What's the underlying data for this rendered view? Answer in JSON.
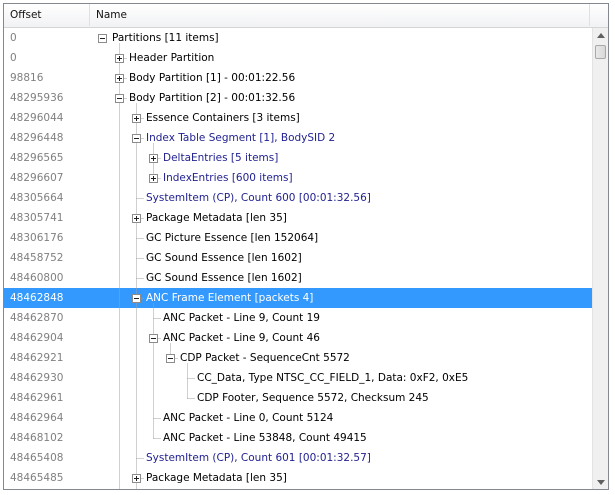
{
  "header": {
    "offset": "Offset",
    "name": "Name"
  },
  "rows": [
    {
      "offset": "0",
      "label": "Partitions [11 items]",
      "depth": 0,
      "expander": "minus",
      "blue": false
    },
    {
      "offset": "0",
      "label": "Header Partition",
      "depth": 1,
      "expander": "plus",
      "blue": false
    },
    {
      "offset": "98816",
      "label": "Body Partition [1] - 00:01:22.56",
      "depth": 1,
      "expander": "plus",
      "blue": false
    },
    {
      "offset": "48295936",
      "label": "Body Partition [2] - 00:01:32.56",
      "depth": 1,
      "expander": "minus",
      "blue": false
    },
    {
      "offset": "48296044",
      "label": "Essence Containers [3 items]",
      "depth": 2,
      "expander": "plus",
      "blue": false
    },
    {
      "offset": "48296448",
      "label": "Index Table Segment [1], BodySID 2",
      "depth": 2,
      "expander": "minus",
      "blue": true
    },
    {
      "offset": "48296565",
      "label": "DeltaEntries [5 items]",
      "depth": 3,
      "expander": "plus",
      "blue": true
    },
    {
      "offset": "48296607",
      "label": "IndexEntries [600 items]",
      "depth": 3,
      "expander": "plus",
      "blue": true
    },
    {
      "offset": "48305664",
      "label": "SystemItem (CP), Count 600 [00:01:32.56]",
      "depth": 2,
      "expander": "none",
      "blue": true
    },
    {
      "offset": "48305741",
      "label": "Package Metadata [len 35]",
      "depth": 2,
      "expander": "plus",
      "blue": false
    },
    {
      "offset": "48306176",
      "label": "GC Picture Essence [len 152064]",
      "depth": 2,
      "expander": "none",
      "blue": false
    },
    {
      "offset": "48458752",
      "label": "GC Sound Essence [len 1602]",
      "depth": 2,
      "expander": "none",
      "blue": false
    },
    {
      "offset": "48460800",
      "label": "GC Sound Essence [len 1602]",
      "depth": 2,
      "expander": "none",
      "blue": false
    },
    {
      "offset": "48462848",
      "label": "ANC Frame Element [packets 4]",
      "depth": 2,
      "expander": "minus",
      "blue": false,
      "selected": true
    },
    {
      "offset": "48462870",
      "label": "ANC Packet - Line 9, Count 19",
      "depth": 3,
      "expander": "none",
      "blue": false
    },
    {
      "offset": "48462904",
      "label": "ANC Packet - Line 9, Count 46",
      "depth": 3,
      "expander": "minus",
      "blue": false
    },
    {
      "offset": "48462921",
      "label": "CDP Packet - SequenceCnt 5572",
      "depth": 4,
      "expander": "minus",
      "blue": false
    },
    {
      "offset": "48462930",
      "label": "CC_Data, Type NTSC_CC_FIELD_1, Data: 0xF2, 0xE5",
      "depth": 5,
      "expander": "none",
      "blue": false
    },
    {
      "offset": "48462961",
      "label": "CDP Footer, Sequence 5572, Checksum 245",
      "depth": 5,
      "expander": "none",
      "blue": false
    },
    {
      "offset": "48462964",
      "label": "ANC Packet - Line 0, Count 5124",
      "depth": 3,
      "expander": "none",
      "blue": false
    },
    {
      "offset": "48468102",
      "label": "ANC Packet - Line 53848, Count 49415",
      "depth": 3,
      "expander": "none",
      "blue": false
    },
    {
      "offset": "48465408",
      "label": "SystemItem (CP), Count 601 [00:01:32.57]",
      "depth": 2,
      "expander": "none",
      "blue": true
    },
    {
      "offset": "48465485",
      "label": "Package Metadata [len 35]",
      "depth": 2,
      "expander": "plus",
      "blue": false
    }
  ]
}
